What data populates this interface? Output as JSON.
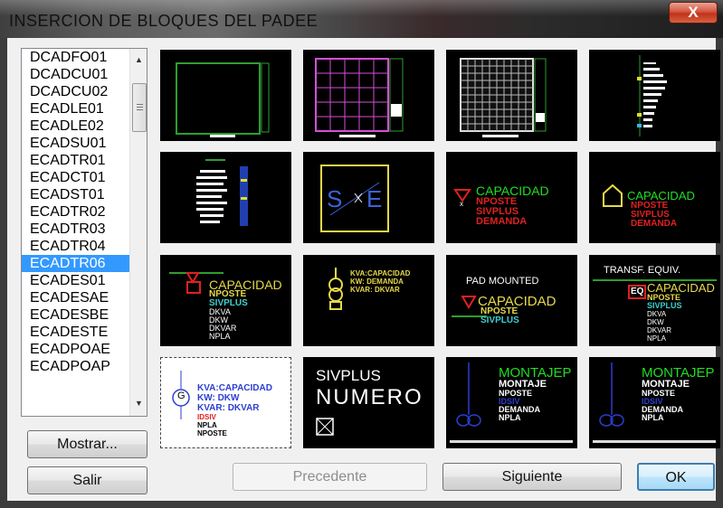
{
  "window": {
    "title": "INSERCION DE BLOQUES DEL PADEE",
    "close_label": "X"
  },
  "list": {
    "items": [
      "DCADFO01",
      "DCADCU01",
      "DCADCU02",
      "ECADLE01",
      "ECADLE02",
      "ECADSU01",
      "ECADTR01",
      "ECADCT01",
      "ECADST01",
      "ECADTR02",
      "ECADTR03",
      "ECADTR04",
      "ECADTR06",
      "ECADES01",
      "ECADESAE",
      "ECADESBE",
      "ECADESTE",
      "ECADPOAE",
      "ECADPOAP"
    ],
    "selected": "ECADTR06"
  },
  "buttons": {
    "mostrar": "Mostrar...",
    "salir": "Salir",
    "precedente": "Precedente",
    "siguiente": "Siguiente",
    "ok": "OK"
  },
  "tiles": {
    "t5": {
      "a": "S",
      "b": "E"
    },
    "t6": {
      "l1": "CAPACIDAD",
      "l2": "NPOSTE",
      "l3": "SIVPLUS",
      "l4": "DEMANDA"
    },
    "t7": {
      "l1": "CAPACIDAD",
      "l2": "NPOSTE",
      "l3": "SIVPLUS",
      "l4": "DEMANDA"
    },
    "t8": {
      "l1": "CAPACIDAD",
      "l2": "NPOSTE",
      "l3": "SIVPLUS",
      "l4": "DKVA",
      "l5": "DKW",
      "l6": "DKVAR",
      "l7": "NPLA"
    },
    "t9": {
      "l1": "KVA:CAPACIDAD",
      "l2": "KW: DEMANDA",
      "l3": "KVAR: DKVAR"
    },
    "t10": {
      "title": "PAD MOUNTED",
      "l1": "CAPACIDAD",
      "l2": "NPOSTE",
      "l3": "SIVPLUS"
    },
    "t11": {
      "title": "TRANSF. EQUIV.",
      "eq": "EQ",
      "l1": "CAPACIDAD",
      "l2": "NPOSTE",
      "l3": "SIVPLUS",
      "l4": "DKVA",
      "l5": "DKW",
      "l6": "DKVAR",
      "l7": "NPLA"
    },
    "t12": {
      "g": "G",
      "l1": "KVA:CAPACIDAD",
      "l2": "KW: DKW",
      "l3": "KVAR: DKVAR",
      "l4": "IDSIV",
      "l5": "NPLA",
      "l6": "NPOSTE"
    },
    "t13": {
      "l1": "SIVPLUS",
      "l2": "NUMERO"
    },
    "t14": {
      "l1": "MONTAJEP",
      "l2": "MONTAJE",
      "l3": "NPOSTE",
      "l4": "IDSIV",
      "l5": "DEMANDA",
      "l6": "NPLA"
    },
    "t15": {
      "l1": "MONTAJEP",
      "l2": "MONTAJE",
      "l3": "NPOSTE",
      "l4": "IDSIV",
      "l5": "DEMANDA",
      "l6": "NPLA"
    }
  }
}
